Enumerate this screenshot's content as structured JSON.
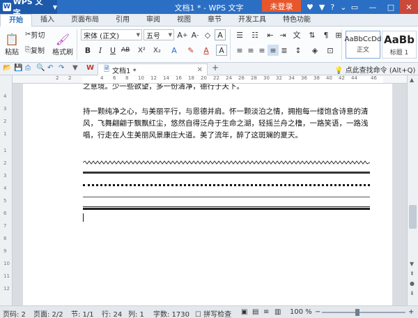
{
  "titlebar": {
    "app_label": "WPS 文字",
    "title": "文档1 * - WPS 文字",
    "login_label": "未登录"
  },
  "tabs": [
    "开始",
    "插入",
    "页面布局",
    "引用",
    "审阅",
    "视图",
    "章节",
    "开发工具",
    "特色功能"
  ],
  "ribbon": {
    "paste": "粘贴",
    "cut": "剪切",
    "copy": "复制",
    "format_painter": "格式刷",
    "font_name": "宋体 (正文)",
    "font_size": "五号",
    "bold": "B",
    "italic": "I",
    "underline": "U",
    "strike": "AB",
    "superscript": "X²",
    "subscript": "X₂",
    "styles": [
      {
        "sample": "AaBbCcDd",
        "name": "正文"
      },
      {
        "sample": "AaBb",
        "name": "标题 1"
      }
    ]
  },
  "doc_tab": {
    "label": "文档1 *"
  },
  "find_command": "点此查找命令 (Alt+Q)",
  "ruler": {
    "top": [
      "2",
      "2",
      "4",
      "6",
      "8",
      "10",
      "12",
      "14",
      "16",
      "18",
      "20",
      "22",
      "24",
      "26",
      "28",
      "30",
      "32",
      "34",
      "36",
      "38",
      "40",
      "42",
      "44",
      "46"
    ],
    "left": [
      "4",
      "3",
      "2",
      "1",
      "1",
      "2",
      "3",
      "4",
      "5",
      "6",
      "7",
      "8",
      "9",
      "10",
      "11",
      "12"
    ]
  },
  "document": {
    "para1": "之意境。少一些欲望，多一份清净，德行于天下。",
    "para2": "持一颗纯净之心，与美丽平行，与恩德并肩。怀一颗淡泊之情，拥抱每一缕饱含诗意的清风，飞舞翩翩于飘飘红尘，悠然自得泛舟于生命之湖，轻摇兰舟之橹，一路笑语，一路浅唱，行走在人生美丽风景康庄大道。美了流年，醉了这斑斓的夏天。"
  },
  "status": {
    "page": "页码: 2",
    "pages": "页面: 2/2",
    "section": "节: 1/1",
    "row": "行: 24",
    "col": "列: 1",
    "words": "字数: 1730",
    "spell": "拼写检查",
    "zoom": "100 %"
  }
}
